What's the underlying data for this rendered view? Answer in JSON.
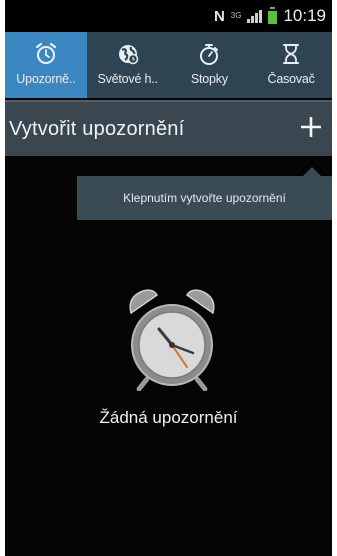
{
  "status_bar": {
    "network_letter": "N",
    "network_type": "3G",
    "time": "10:19"
  },
  "tabs": [
    {
      "label": "Upozorně..",
      "icon": "alarm-clock-icon",
      "active": true
    },
    {
      "label": "Světové h..",
      "icon": "world-clock-icon",
      "active": false
    },
    {
      "label": "Stopky",
      "icon": "stopwatch-icon",
      "active": false
    },
    {
      "label": "Časovač",
      "icon": "hourglass-icon",
      "active": false
    }
  ],
  "action_bar": {
    "title": "Vytvořit upozornění",
    "add_icon": "plus-icon"
  },
  "tooltip": {
    "text": "Klepnutím vytvořte upozornění"
  },
  "empty_state": {
    "icon": "alarm-clock-icon",
    "text": "Žádná upozornění"
  },
  "colors": {
    "active_tab": "#3b87c2",
    "tab_bar": "#2f4453",
    "action_bar": "#3a4750",
    "background": "#050505",
    "battery": "#59c23a",
    "clock_hand_accent": "#d9762a"
  }
}
